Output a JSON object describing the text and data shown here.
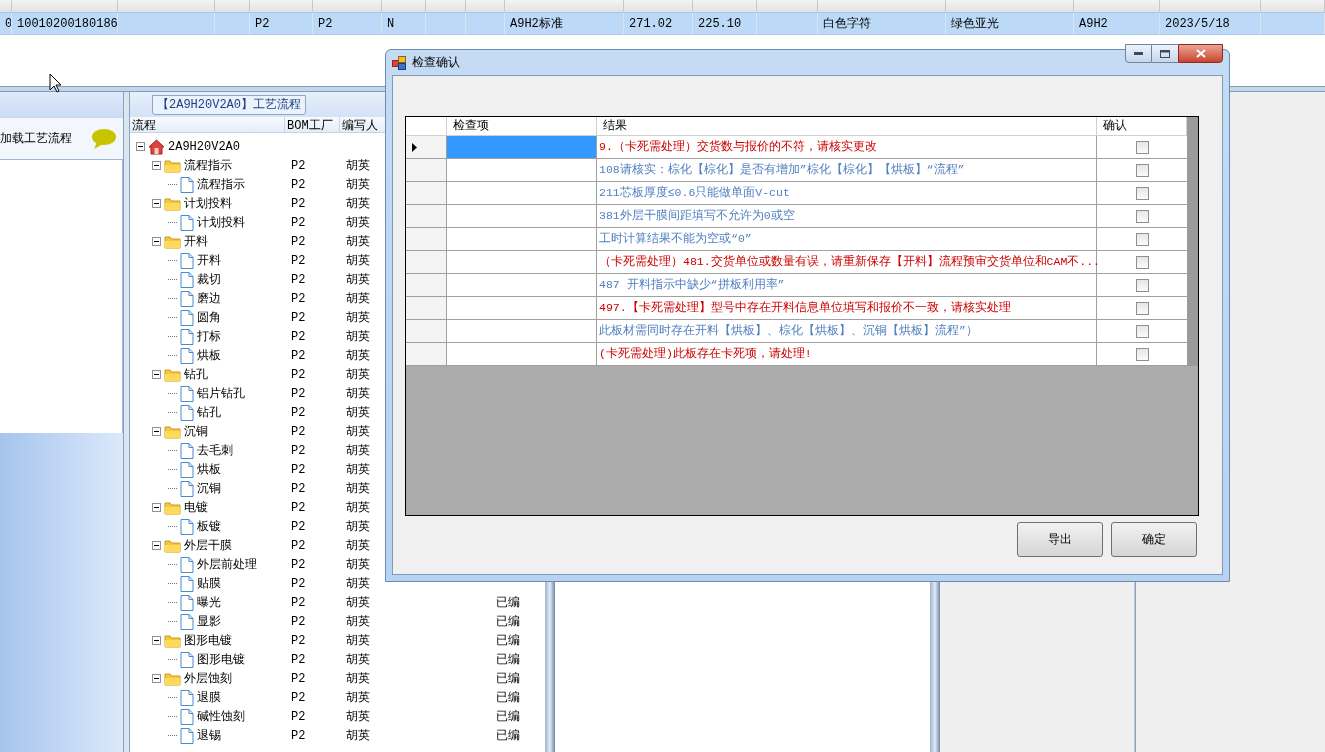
{
  "record_grid": {
    "row": {
      "selected": true,
      "cells": [
        {
          "text": "0"
        },
        {
          "text": "10010200180186"
        },
        {},
        {},
        {
          "text": "P2"
        },
        {
          "text": "P2"
        },
        {
          "text": "N"
        },
        {},
        {},
        {
          "text": "A9H2标准"
        },
        {
          "text": "271.02"
        },
        {
          "text": "225.10"
        },
        {},
        {
          "text": "白色字符"
        },
        {
          "text": "绿色亚光"
        },
        {
          "text": "A9H2"
        },
        {
          "text": "2023/5/18"
        },
        {}
      ]
    }
  },
  "left_panel": {
    "title": "加载工艺流程"
  },
  "process_panel": {
    "title": "【2A9H20V2A0】工艺流程",
    "columns": [
      "流程",
      "BOM工厂",
      "编写人"
    ],
    "tree": {
      "nodes": [
        {
          "kind": "root",
          "name": "2A9H20V2A0",
          "expanded": true,
          "children": [
            {
              "kind": "folder",
              "name": "流程指示",
              "bom": "P2",
              "author": "胡英",
              "expanded": true,
              "children": [
                {
                  "kind": "page",
                  "name": "流程指示",
                  "bom": "P2",
                  "author": "胡英"
                }
              ]
            },
            {
              "kind": "folder",
              "name": "计划投料",
              "bom": "P2",
              "author": "胡英",
              "expanded": true,
              "children": [
                {
                  "kind": "page",
                  "name": "计划投料",
                  "bom": "P2",
                  "author": "胡英"
                }
              ]
            },
            {
              "kind": "folder",
              "name": "开料",
              "bom": "P2",
              "author": "胡英",
              "expanded": true,
              "children": [
                {
                  "kind": "page",
                  "name": "开料",
                  "bom": "P2",
                  "author": "胡英"
                },
                {
                  "kind": "page",
                  "name": "裁切",
                  "bom": "P2",
                  "author": "胡英"
                },
                {
                  "kind": "page",
                  "name": "磨边",
                  "bom": "P2",
                  "author": "胡英"
                },
                {
                  "kind": "page",
                  "name": "圆角",
                  "bom": "P2",
                  "author": "胡英"
                },
                {
                  "kind": "page",
                  "name": "打标",
                  "bom": "P2",
                  "author": "胡英"
                },
                {
                  "kind": "page",
                  "name": "烘板",
                  "bom": "P2",
                  "author": "胡英"
                }
              ]
            },
            {
              "kind": "folder",
              "name": "钻孔",
              "bom": "P2",
              "author": "胡英",
              "expanded": true,
              "children": [
                {
                  "kind": "page",
                  "name": "铝片钻孔",
                  "bom": "P2",
                  "author": "胡英"
                },
                {
                  "kind": "page",
                  "name": "钻孔",
                  "bom": "P2",
                  "author": "胡英"
                }
              ]
            },
            {
              "kind": "folder",
              "name": "沉铜",
              "bom": "P2",
              "author": "胡英",
              "expanded": true,
              "children": [
                {
                  "kind": "page",
                  "name": "去毛刺",
                  "bom": "P2",
                  "author": "胡英"
                },
                {
                  "kind": "page",
                  "name": "烘板",
                  "bom": "P2",
                  "author": "胡英"
                },
                {
                  "kind": "page",
                  "name": "沉铜",
                  "bom": "P2",
                  "author": "胡英"
                }
              ]
            },
            {
              "kind": "folder",
              "name": "电镀",
              "bom": "P2",
              "author": "胡英",
              "expanded": true,
              "children": [
                {
                  "kind": "page",
                  "name": "板镀",
                  "bom": "P2",
                  "author": "胡英"
                }
              ]
            },
            {
              "kind": "folder",
              "name": "外层干膜",
              "bom": "P2",
              "author": "胡英",
              "expanded": true,
              "children": [
                {
                  "kind": "page",
                  "name": "外层前处理",
                  "bom": "P2",
                  "author": "胡英"
                },
                {
                  "kind": "page",
                  "name": "贴膜",
                  "bom": "P2",
                  "author": "胡英"
                },
                {
                  "kind": "page",
                  "name": "曝光",
                  "bom": "P2",
                  "author": "胡英",
                  "status": "已编"
                },
                {
                  "kind": "page",
                  "name": "显影",
                  "bom": "P2",
                  "author": "胡英",
                  "status": "已编"
                }
              ]
            },
            {
              "kind": "folder",
              "name": "图形电镀",
              "bom": "P2",
              "author": "胡英",
              "status": "已编",
              "expanded": true,
              "children": [
                {
                  "kind": "page",
                  "name": "图形电镀",
                  "bom": "P2",
                  "author": "胡英",
                  "status": "已编"
                }
              ]
            },
            {
              "kind": "folder",
              "name": "外层蚀刻",
              "bom": "P2",
              "author": "胡英",
              "status": "已编",
              "expanded": true,
              "children": [
                {
                  "kind": "page",
                  "name": "退膜",
                  "bom": "P2",
                  "author": "胡英",
                  "status": "已编"
                },
                {
                  "kind": "page",
                  "name": "碱性蚀刻",
                  "bom": "P2",
                  "author": "胡英",
                  "status": "已编"
                },
                {
                  "kind": "page",
                  "name": "退锡",
                  "bom": "P2",
                  "author": "胡英",
                  "status": "已编"
                }
              ]
            }
          ]
        }
      ]
    }
  },
  "dialog": {
    "title": "检查确认",
    "columns": [
      "检查项",
      "结果",
      "确认"
    ],
    "rows": [
      {
        "selected": true,
        "result": "9.（卡死需处理）交货数与报价的不符，请核实更改",
        "color": "#cc0000",
        "checked": false
      },
      {
        "selected": false,
        "result": "108请核实：棕化【棕化】是否有增加”棕化【棕化】【烘板】“流程”",
        "color": "#4f7fc0",
        "checked": false
      },
      {
        "selected": false,
        "result": "211芯板厚度≤0.6只能做单面V-cut",
        "color": "#4f7fc0",
        "checked": false
      },
      {
        "selected": false,
        "result": "381外层干膜间距填写不允许为0或空",
        "color": "#4f7fc0",
        "checked": false
      },
      {
        "selected": false,
        "result": "工时计算结果不能为空或“0”",
        "color": "#4f7fc0",
        "checked": false
      },
      {
        "selected": false,
        "result": "（卡死需处理）481.交货单位或数量有误，请重新保存【开料】流程预审交货单位和CAM不...",
        "color": "#cc0000",
        "checked": false
      },
      {
        "selected": false,
        "result": "487 开料指示中缺少“拼板利用率”",
        "color": "#4f7fc0",
        "checked": false
      },
      {
        "selected": false,
        "result": "497.【卡死需处理】型号中存在开料信息单位填写和报价不一致，请核实处理",
        "color": "#cc0000",
        "checked": false
      },
      {
        "selected": false,
        "result": "此板材需同时存在开料【烘板】、棕化【烘板】、沉铜【烘板】流程”）",
        "color": "#4f7fc0",
        "checked": false
      },
      {
        "selected": false,
        "result": "(卡死需处理)此板存在卡死项，请处理!",
        "color": "#cc0000",
        "checked": false
      }
    ],
    "buttons": [
      "导出",
      "确定"
    ]
  }
}
